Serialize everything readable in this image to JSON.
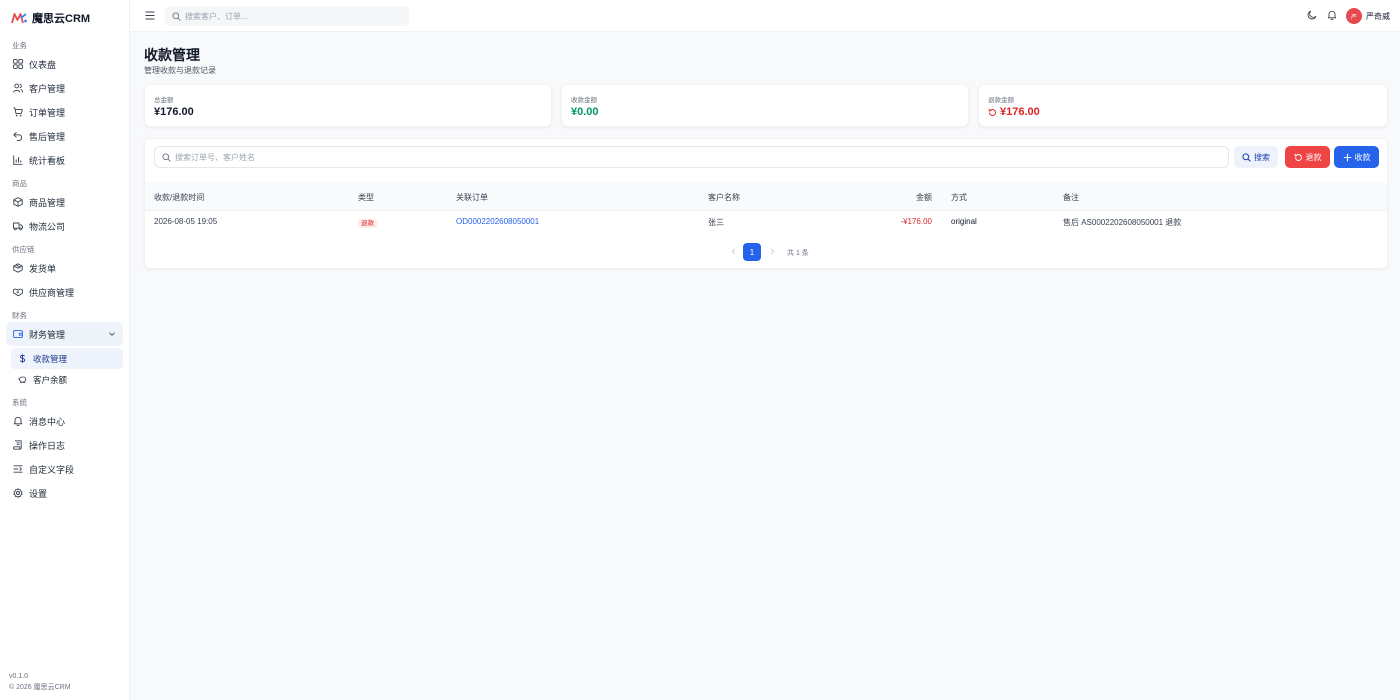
{
  "app": {
    "brand_name": "魔思云CRM",
    "version": "v0.1.0",
    "copyright": "© 2026 魔思云CRM"
  },
  "sidebar": {
    "groups": [
      {
        "title": "业务",
        "items": [
          {
            "label": "仪表盘",
            "icon": "dashboard-icon"
          },
          {
            "label": "客户管理",
            "icon": "users-icon"
          },
          {
            "label": "订单管理",
            "icon": "cart-icon"
          },
          {
            "label": "售后管理",
            "icon": "undo-icon"
          },
          {
            "label": "统计看板",
            "icon": "bar-chart-icon"
          }
        ]
      },
      {
        "title": "商品",
        "items": [
          {
            "label": "商品管理",
            "icon": "package-icon"
          },
          {
            "label": "物流公司",
            "icon": "truck-icon"
          }
        ]
      },
      {
        "title": "供应链",
        "items": [
          {
            "label": "发货单",
            "icon": "box-icon"
          },
          {
            "label": "供应商管理",
            "icon": "handshake-icon"
          }
        ]
      },
      {
        "title": "财务",
        "items": [
          {
            "label": "财务管理",
            "icon": "wallet-icon",
            "expanded": true,
            "children": [
              {
                "label": "收款管理",
                "icon": "dollar-icon",
                "active": true
              },
              {
                "label": "客户余额",
                "icon": "piggy-bank-icon"
              }
            ]
          }
        ]
      },
      {
        "title": "系统",
        "items": [
          {
            "label": "消息中心",
            "icon": "bell-icon"
          },
          {
            "label": "操作日志",
            "icon": "scroll-icon"
          },
          {
            "label": "自定义字段",
            "icon": "fields-icon"
          },
          {
            "label": "设置",
            "icon": "gear-icon"
          }
        ]
      }
    ]
  },
  "header": {
    "search_placeholder": "搜索客户、订单...",
    "user_initial": "严",
    "user_name": "严奇威"
  },
  "page": {
    "title": "收款管理",
    "subtitle": "管理收款与退款记录"
  },
  "stats": [
    {
      "label": "总金额",
      "value": "¥176.00",
      "color": "#111827"
    },
    {
      "label": "收款金额",
      "value": "¥0.00",
      "color": "#059669"
    },
    {
      "label": "退款金额",
      "value": "¥176.00",
      "color": "#dc2626",
      "icon": "refund-icon"
    }
  ],
  "filters": {
    "search_placeholder": "搜索订单号、客户姓名",
    "search_button": "搜索",
    "refund_button": "退款",
    "collect_button": "收款"
  },
  "table": {
    "columns": [
      "收款/退款时间",
      "类型",
      "关联订单",
      "客户名称",
      "金额",
      "方式",
      "备注"
    ],
    "rows": [
      {
        "time": "2026-08-05 19:05",
        "type": "退款",
        "order": "OD0002202608050001",
        "customer": "张三",
        "amount": "-¥176.00",
        "method": "original",
        "note": "售后 AS0002202608050001 退款"
      }
    ]
  },
  "pagination": {
    "current_page": "1",
    "total_text": "共 1 条"
  },
  "colors": {
    "primary": "#2563eb",
    "danger": "#ef4444",
    "success": "#059669"
  }
}
